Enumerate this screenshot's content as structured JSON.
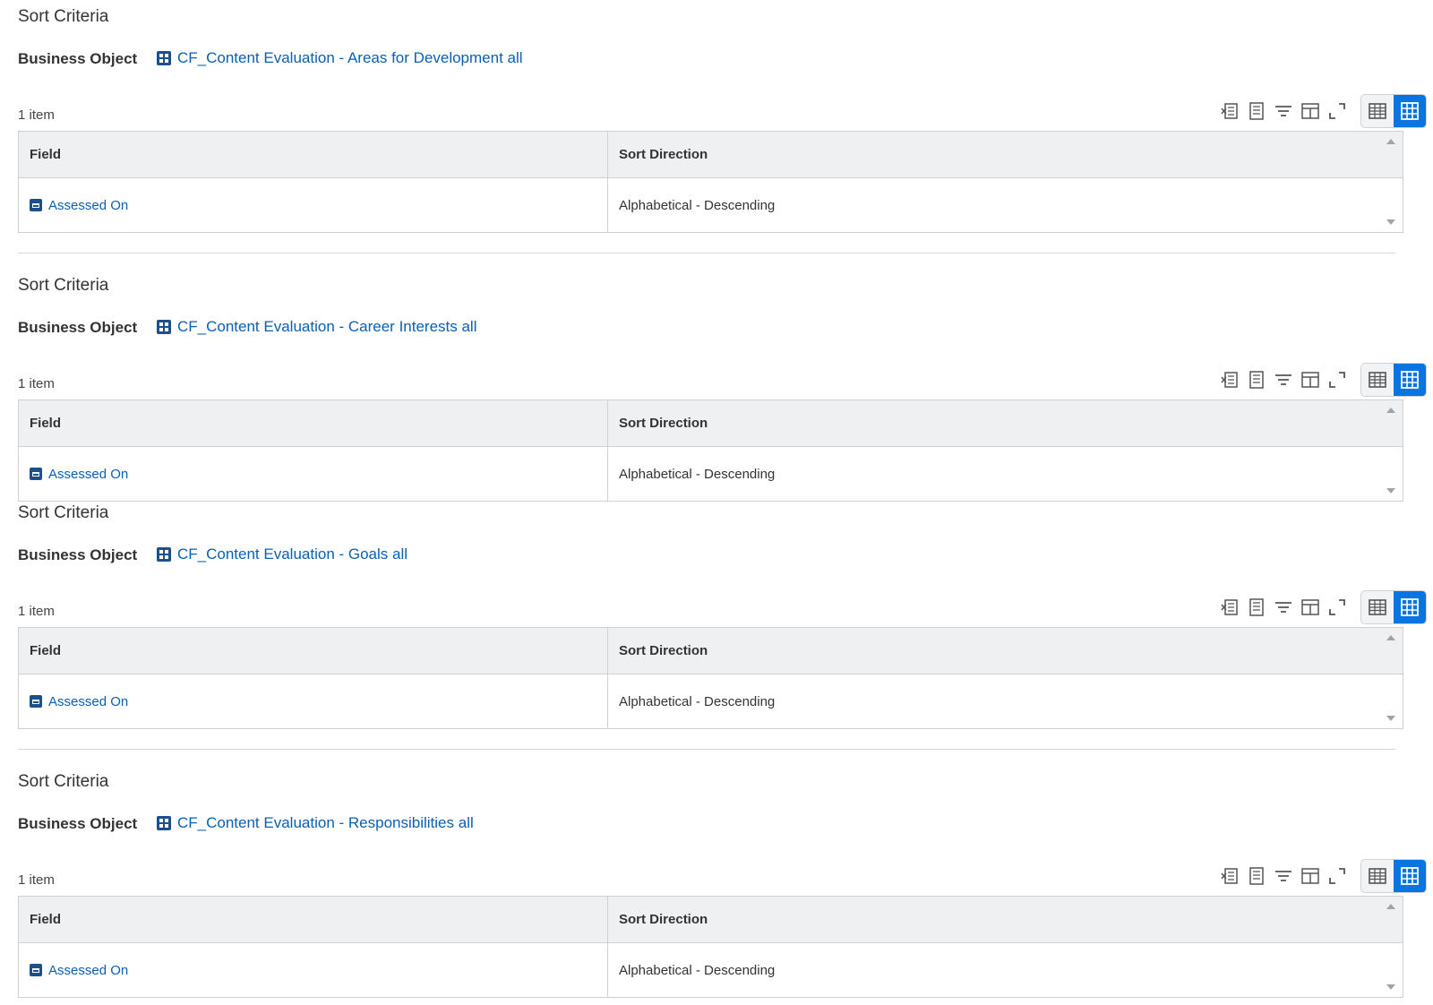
{
  "colors": {
    "link": "#0b5fb3",
    "accent": "#0875e1",
    "icon_dark": "#1d4f8c"
  },
  "toolbar_icons": [
    "export-excel-icon",
    "export-pdf-icon",
    "filter-icon",
    "columns-icon",
    "expand-icon",
    "table-view-icon",
    "grid-view-icon"
  ],
  "sections": [
    {
      "title": "Sort Criteria",
      "business_object_label": "Business Object",
      "business_object_link": "CF_Content Evaluation - Areas for Development all",
      "count": "1 item",
      "columns": [
        "Field",
        "Sort Direction"
      ],
      "rows": [
        {
          "field": "Assessed On",
          "direction": "Alphabetical - Descending"
        }
      ]
    },
    {
      "title": "Sort Criteria",
      "business_object_label": "Business Object",
      "business_object_link": "CF_Content Evaluation - Career Interests all",
      "count": "1 item",
      "columns": [
        "Field",
        "Sort Direction"
      ],
      "rows": [
        {
          "field": "Assessed On",
          "direction": "Alphabetical - Descending"
        }
      ]
    },
    {
      "title": "Sort Criteria",
      "business_object_label": "Business Object",
      "business_object_link": "CF_Content Evaluation - Goals all",
      "count": "1 item",
      "columns": [
        "Field",
        "Sort Direction"
      ],
      "rows": [
        {
          "field": "Assessed On",
          "direction": "Alphabetical - Descending"
        }
      ]
    },
    {
      "title": "Sort Criteria",
      "business_object_label": "Business Object",
      "business_object_link": "CF_Content Evaluation - Responsibilities all",
      "count": "1 item",
      "columns": [
        "Field",
        "Sort Direction"
      ],
      "rows": [
        {
          "field": "Assessed On",
          "direction": "Alphabetical - Descending"
        }
      ]
    }
  ]
}
